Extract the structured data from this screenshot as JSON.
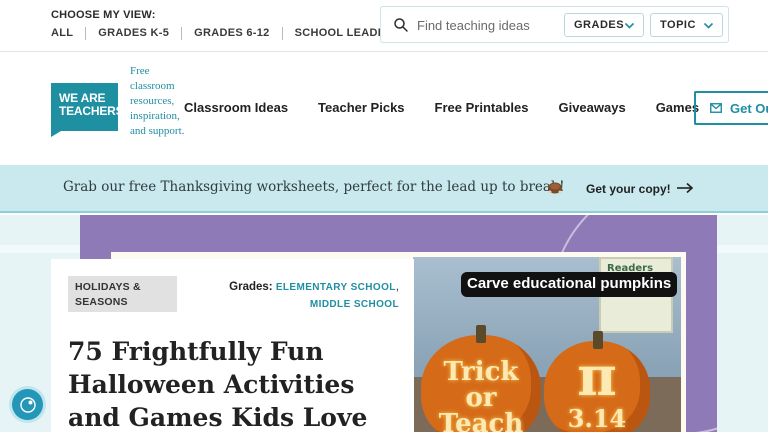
{
  "topbar": {
    "choose_label": "CHOOSE MY VIEW:",
    "view_links": [
      "ALL",
      "GRADES K-5",
      "GRADES 6-12",
      "SCHOOL LEADERS"
    ],
    "search": {
      "placeholder": "Find teaching ideas",
      "value": ""
    },
    "dropdowns": {
      "grades": "GRADES",
      "topic": "TOPIC"
    }
  },
  "header": {
    "logo_text": "WE ARE TEACHERS",
    "tagline": "Free classroom resources, inspiration, and support.",
    "nav": [
      "Classroom Ideas",
      "Teacher Picks",
      "Free Printables",
      "Giveaways",
      "Games"
    ],
    "cta": "Get Ou"
  },
  "promo": {
    "text": "Grab our free Thanksgiving worksheets, perfect for the lead up to break!",
    "icon": "turkey-icon",
    "cta": "Get your copy!"
  },
  "article": {
    "category": "HOLIDAYS & SEASONS",
    "grades_label": "Grades:",
    "grades": [
      "ELEMENTARY SCHOOL",
      "MIDDLE SCHOOL"
    ],
    "grades_sep": ",",
    "title": "75 Frightfully Fun Halloween Activities and Games Kids Love",
    "image": {
      "caption": "Carve educational pumpkins",
      "poster_text": "Readers Gonna Read",
      "pumpkin1_text": "Trick or Teach",
      "pumpkin2_symbol": "π",
      "pumpkin2_number": "3.14"
    }
  },
  "colors": {
    "accent": "#1f8fa2",
    "promo_bg": "#c9e9ee",
    "hero_purple": "#8e7ab6",
    "fab": "#2497b8"
  }
}
